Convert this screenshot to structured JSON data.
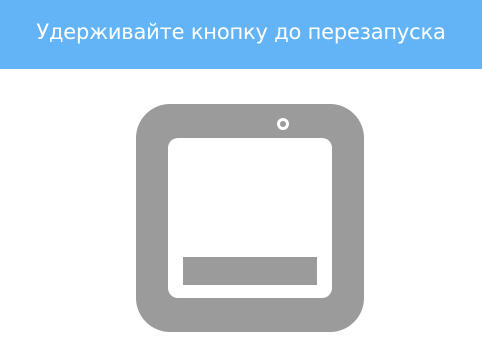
{
  "header": {
    "title": "Удерживайте кнопку до перезапуска"
  },
  "illustration": {
    "icon": "device-restart-button-icon",
    "colors": {
      "device": "#9b9b9b",
      "screen": "#ffffff"
    }
  },
  "colors": {
    "header_background": "#63b4f7",
    "header_text": "#ffffff",
    "page_background": "#ffffff"
  }
}
